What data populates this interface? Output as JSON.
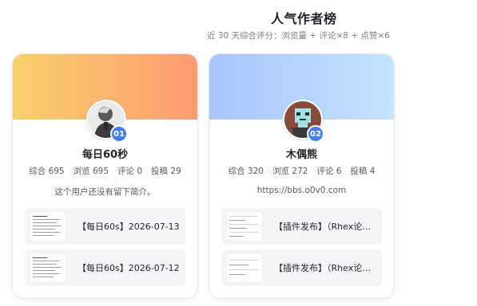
{
  "header": {
    "title": "人气作者榜",
    "subtitle": "近 30 天综合评分：浏览量 + 评论×8 + 点赞×6"
  },
  "authors": [
    {
      "rank": "01",
      "name": "每日60秒",
      "stats": [
        "综合 695",
        "浏览 695",
        "评论 0",
        "投稿 29"
      ],
      "bio": "这个用户还没有留下简介。",
      "posts": [
        {
          "title": "【每日60s】2026-07-13"
        },
        {
          "title": "【每日60s】2026-07-12"
        }
      ]
    },
    {
      "rank": "02",
      "name": "木偶熊",
      "stats": [
        "综合 320",
        "浏览 272",
        "评论 6",
        "投稿 4"
      ],
      "bio": "https://bbs.o0v0.com",
      "posts": [
        {
          "title": "【插件发布】（Rhex论坛插件）"
        },
        {
          "title": "【插件发布】（Rhex论坛插件）"
        }
      ]
    }
  ],
  "colors": {
    "accent": "#3f7ef5",
    "card1_banner": "#fbb46f",
    "card2_banner": "#b7d6ff"
  }
}
